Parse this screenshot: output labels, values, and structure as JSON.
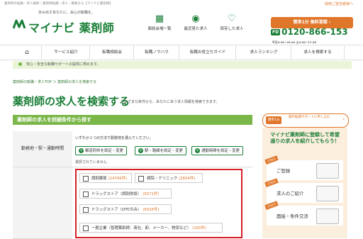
{
  "top_note": "薬剤師の転職・求人検索｜薬剤師転職・求人・募集なら【マイナビ薬剤師】",
  "hiring_link": "採用ご担当者様へ",
  "brand": {
    "tagline": "歩み出すあなたに、会心の転職を。",
    "name": "マイナビ 薬剤師"
  },
  "header_icons": [
    {
      "label": "面談会場一覧",
      "icon": "building-icon"
    },
    {
      "label": "最近見た求人",
      "icon": "eye-icon"
    },
    {
      "label": "保存した求人",
      "icon": "heart-icon"
    }
  ],
  "cta": {
    "label": "簡単1分 無料登録 ›"
  },
  "phone": {
    "badge": "FD",
    "number": "0120-866-153",
    "note": "平日9:30~20:30 土9:30~17:30"
  },
  "nav": {
    "home_icon": "home-icon",
    "items": [
      "サービス紹介",
      "転職相談会",
      "転職ノウハウ",
      "転職お役立ちガイド",
      "求人ランキング",
      "求人を検索する"
    ]
  },
  "notice": "安心・安全な転職サポートの提供に努めます。",
  "breadcrumb": "薬剤師の転職・求人TOP ＞ 薬剤師の求人を検索する",
  "page": {
    "title": "薬剤師の求人を検索する",
    "subtitle": "さまざまな条件から、あなたにあう求人情報を検索できます。"
  },
  "section": {
    "title": "薬剤師の求人を詳細条件から探す"
  },
  "form": {
    "location_label": "勤務地・駅・通勤時間",
    "hint": "いずれか１つの方法で勤務地を選んでください。",
    "buttons": [
      "都道府県を設定・変更",
      "駅・路線を設定・変更",
      "通勤時間を設定・変更"
    ],
    "none_selected": "選択されていません",
    "options": [
      {
        "label": "調剤薬局",
        "count": "(24766件)"
      },
      {
        "label": "病院・クリニック",
        "count": "(2654件)"
      },
      {
        "label": "ドラッグストア（調剤併設）",
        "count": "(5571件)"
      },
      {
        "label": "ドラッグストア（OTCのみ）",
        "count": "(6526件)"
      },
      {
        "label": "一般企業（管理薬剤師：商社、卸、メーカー、物流など）",
        "count": "(165件)"
      }
    ]
  },
  "sidebar": {
    "cta_tag": "簡単1分",
    "cta_text": "無料転職サポートに申し込む",
    "heading": "マイナビ薬剤師に登録して希望通りの求人を紹介してもらう！",
    "steps": [
      {
        "badge": "STEP1",
        "label": "ご登録"
      },
      {
        "badge": "STEP2",
        "label": "求人のご紹介"
      },
      {
        "badge": "STEP3",
        "label": "面接・条件交渉"
      }
    ]
  }
}
